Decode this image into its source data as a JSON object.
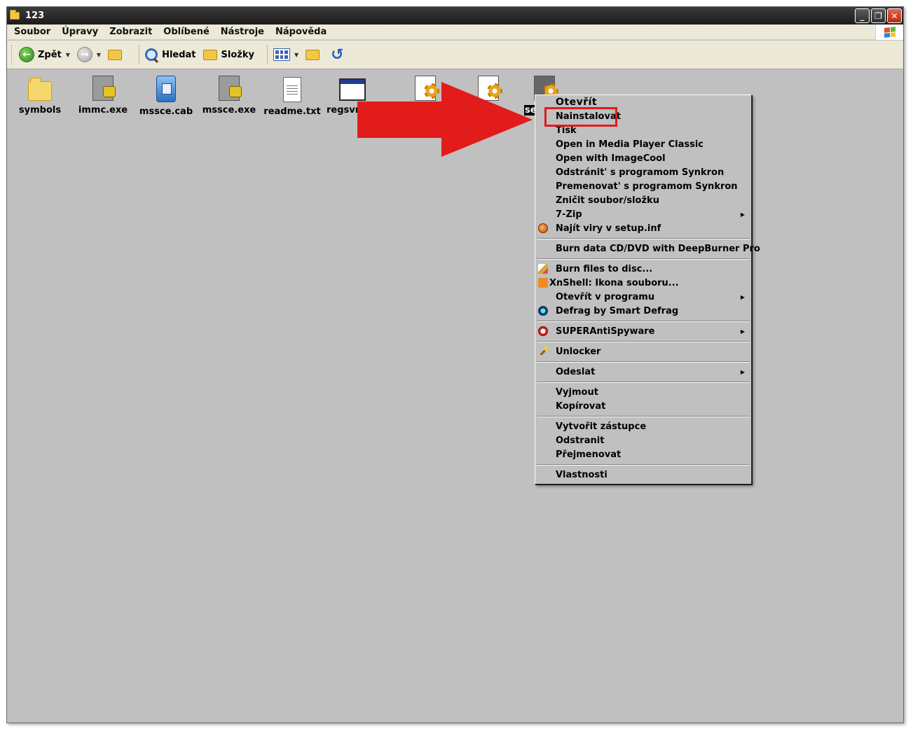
{
  "window": {
    "title": "123",
    "controls": {
      "minimize": "_",
      "maximize": "❐",
      "close": "✕"
    }
  },
  "menubar": [
    "Soubor",
    "Úpravy",
    "Zobrazit",
    "Oblíbené",
    "Nástroje",
    "Nápověda"
  ],
  "toolbar": {
    "back_label": "Zpět",
    "search_label": "Hledat",
    "folders_label": "Složky"
  },
  "files": [
    {
      "name": "symbols",
      "icon": "folder-icon"
    },
    {
      "name": "immc.exe",
      "icon": "exe-icon"
    },
    {
      "name": "mssce.cab",
      "icon": "cab-icon"
    },
    {
      "name": "mssce.exe",
      "icon": "installer-icon"
    },
    {
      "name": "readme.txt",
      "icon": "text-document-icon"
    },
    {
      "name": "regsvr3",
      "icon": "window-icon"
    },
    {
      "name": "",
      "icon": "setup-info-icon"
    },
    {
      "name": "",
      "icon": "setup-info-icon"
    },
    {
      "name": "se",
      "icon": "setup-info-icon",
      "selected": true
    }
  ],
  "context_menu": {
    "open": "Otevřít",
    "install": "Nainstalovat",
    "print": "Tisk",
    "open_mpc": "Open in Media Player Classic",
    "open_imagecool": "Open with ImageCool",
    "remove_synkron": "Odstránit' s programom Synkron",
    "rename_synkron": "Premenovat' s programom Synkron",
    "shred": "Zničit soubor/složku",
    "sevenzip": "7-Zip",
    "scan_virus": "Najít viry v setup.inf",
    "burn_deepburner": "Burn data CD/DVD with DeepBurner Pro",
    "burn_files": "Burn files to disc...",
    "xnshell": "XnShell: Ikona souboru...",
    "open_with": "Otevřít v programu",
    "defrag": "Defrag by Smart Defrag",
    "superantispyware": "SUPERAntiSpyware",
    "unlocker": "Unlocker",
    "send_to": "Odeslat",
    "cut": "Vyjmout",
    "copy": "Kopírovat",
    "create_shortcut": "Vytvořit zástupce",
    "delete": "Odstranit",
    "rename": "Přejmenovat",
    "properties": "Vlastnosti",
    "submenu_arrow": "▶"
  },
  "colors": {
    "annotation_red": "#e21b1b",
    "window_bg": "#c0c0c0",
    "titlebar": "#1c1c1c"
  }
}
